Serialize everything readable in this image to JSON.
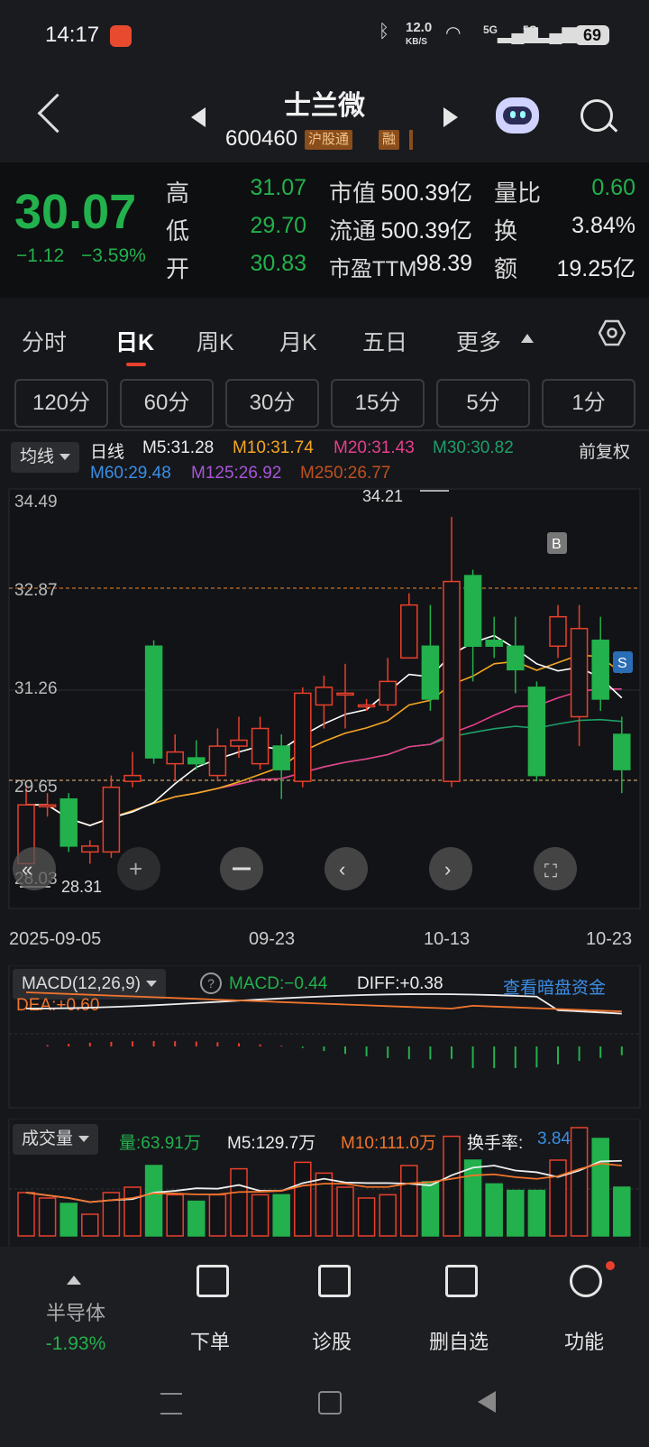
{
  "status_bar": {
    "time": "14:17",
    "net_speed_top": "12.0",
    "net_speed_bottom": "KB/S",
    "signal1": "5G",
    "signal2": "5G",
    "battery": "69"
  },
  "header": {
    "name": "士兰微",
    "code": "600460",
    "tag1": "沪股通",
    "tag2": "融"
  },
  "quote": {
    "price": "30.07",
    "change": "−1.12",
    "change_pct": "−3.59%",
    "high_label": "高",
    "high": "31.07",
    "low_label": "低",
    "low": "29.70",
    "open_label": "开",
    "open": "30.83",
    "mktcap_label": "市值",
    "mktcap": "500.39亿",
    "float_label": "流通",
    "float": "500.39亿",
    "pe_label": "市盈TTM",
    "pe": "98.39",
    "vr_label": "量比",
    "vr": "0.60",
    "turnover_label": "换",
    "turnover": "3.84%",
    "amount_label": "额",
    "amount": "19.25亿"
  },
  "tabs": [
    "分时",
    "日K",
    "周K",
    "月K",
    "五日",
    "更多"
  ],
  "periods": [
    "120分",
    "60分",
    "30分",
    "15分",
    "5分",
    "1分"
  ],
  "ma_row": {
    "selector": "均线",
    "kind": "日线",
    "m5": "M5:31.28",
    "m10": "M10:31.74",
    "m20": "M20:31.43",
    "m30": "M30:30.82",
    "m60": "M60:29.48",
    "m125": "M125:26.92",
    "m250": "M250:26.77",
    "adjust": "前复权"
  },
  "colors": {
    "up": "#e8402c",
    "down": "#22b14c",
    "m5": "#ffffff",
    "m10": "#f5a623",
    "m20": "#e83e8c",
    "m30": "#1e9e6a",
    "m60": "#3a8ee6",
    "m125": "#a855d6",
    "m250": "#c0501d"
  },
  "price_chart": {
    "y_labels": [
      "34.49",
      "32.87",
      "31.26",
      "29.65",
      "28.03"
    ],
    "max_label": "34.21",
    "min_label": "28.31",
    "dates": [
      "2025-09-05",
      "09-23",
      "10-13",
      "10-23"
    ],
    "buy_marker": "B",
    "sell_marker": "S"
  },
  "chart_data": {
    "type": "candlestick",
    "candles": [
      {
        "o": 28.3,
        "c": 29.3,
        "h": 29.6,
        "l": 28.3
      },
      {
        "o": 29.3,
        "c": 29.3,
        "h": 29.5,
        "l": 29.1
      },
      {
        "o": 29.4,
        "c": 28.6,
        "h": 29.5,
        "l": 28.5
      },
      {
        "o": 28.5,
        "c": 28.6,
        "h": 28.7,
        "l": 28.3
      },
      {
        "o": 28.5,
        "c": 29.6,
        "h": 29.8,
        "l": 28.4
      },
      {
        "o": 29.7,
        "c": 29.8,
        "h": 30.2,
        "l": 29.6
      },
      {
        "o": 32.0,
        "c": 30.1,
        "h": 32.1,
        "l": 30.0
      },
      {
        "o": 30.0,
        "c": 30.2,
        "h": 30.5,
        "l": 29.7
      },
      {
        "o": 30.1,
        "c": 30.0,
        "h": 30.4,
        "l": 29.9
      },
      {
        "o": 29.8,
        "c": 30.3,
        "h": 30.6,
        "l": 29.7
      },
      {
        "o": 30.3,
        "c": 30.4,
        "h": 30.8,
        "l": 30.1
      },
      {
        "o": 30.0,
        "c": 30.6,
        "h": 30.8,
        "l": 29.9
      },
      {
        "o": 30.3,
        "c": 29.9,
        "h": 30.5,
        "l": 29.4
      },
      {
        "o": 29.7,
        "c": 31.2,
        "h": 31.3,
        "l": 29.6
      },
      {
        "o": 31.0,
        "c": 31.3,
        "h": 31.5,
        "l": 30.6
      },
      {
        "o": 31.2,
        "c": 31.2,
        "h": 31.7,
        "l": 30.6
      },
      {
        "o": 31.0,
        "c": 31.0,
        "h": 31.1,
        "l": 30.9
      },
      {
        "o": 31.0,
        "c": 31.4,
        "h": 31.8,
        "l": 30.9
      },
      {
        "o": 31.8,
        "c": 32.7,
        "h": 32.9,
        "l": 31.8
      },
      {
        "o": 32.0,
        "c": 31.1,
        "h": 32.7,
        "l": 30.9
      },
      {
        "o": 29.7,
        "c": 33.1,
        "h": 34.2,
        "l": 29.6
      },
      {
        "o": 33.2,
        "c": 32.0,
        "h": 33.3,
        "l": 31.4
      },
      {
        "o": 32.1,
        "c": 32.0,
        "h": 32.5,
        "l": 31.8
      },
      {
        "o": 32.0,
        "c": 31.6,
        "h": 32.5,
        "l": 31.2
      },
      {
        "o": 31.3,
        "c": 29.8,
        "h": 31.4,
        "l": 29.7
      },
      {
        "o": 32.0,
        "c": 32.5,
        "h": 32.7,
        "l": 31.8
      },
      {
        "o": 30.8,
        "c": 32.3,
        "h": 32.7,
        "l": 30.3
      },
      {
        "o": 32.1,
        "c": 31.1,
        "h": 32.5,
        "l": 30.9
      },
      {
        "o": 30.5,
        "c": 29.9,
        "h": 30.8,
        "l": 29.5
      }
    ],
    "ylim": [
      28.03,
      34.49
    ]
  },
  "macd": {
    "selector": "MACD(12,26,9)",
    "macd": "MACD:−0.44",
    "diff": "DIFF:+0.38",
    "dea": "DEA:+0.60",
    "dark_pool_link": "查看暗盘资金"
  },
  "volume": {
    "selector": "成交量",
    "vol": "量:63.91万",
    "m5": "M5:129.7万",
    "m10": "M10:111.0万",
    "turnover_label": "换手率:",
    "turnover": "3.84%"
  },
  "bottom_nav": {
    "sector": "半导体",
    "sector_pct": "-1.93%",
    "order": "下单",
    "diagnose": "诊股",
    "delete_watch": "删自选",
    "functions": "功能"
  }
}
